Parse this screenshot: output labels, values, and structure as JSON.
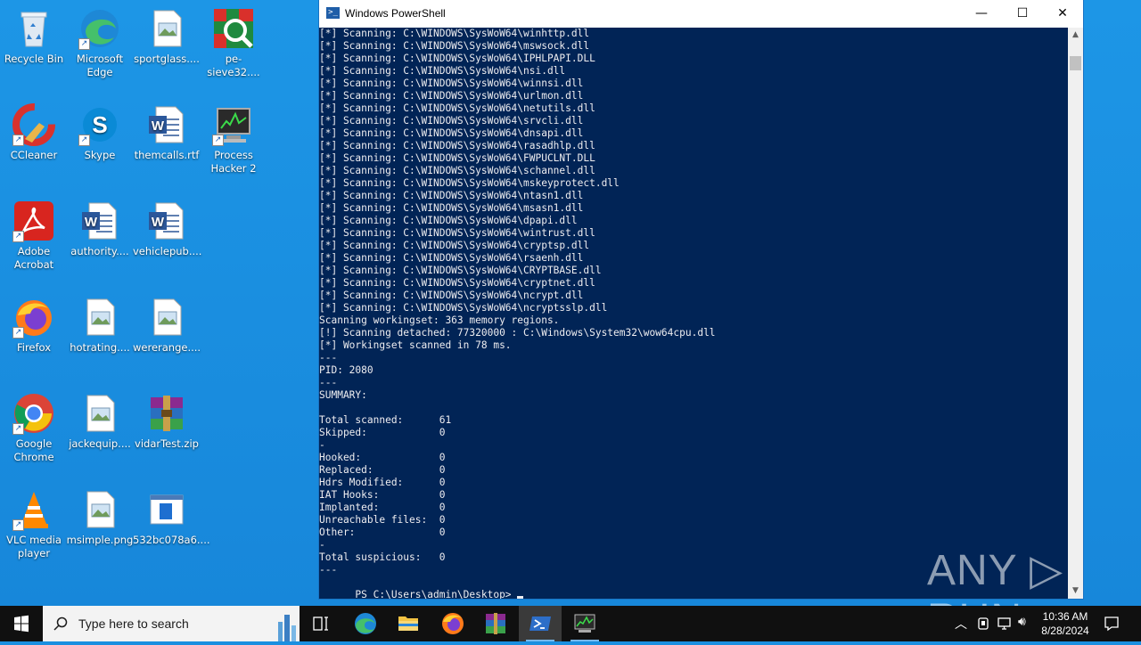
{
  "desktop_icons": [
    {
      "label": "Recycle Bin"
    },
    {
      "label": "Microsoft Edge"
    },
    {
      "label": "sportglass...."
    },
    {
      "label": "pe-sieve32...."
    },
    {
      "label": "CCleaner"
    },
    {
      "label": "Skype"
    },
    {
      "label": "themcalls.rtf"
    },
    {
      "label": "Process Hacker 2"
    },
    {
      "label": "Adobe Acrobat"
    },
    {
      "label": "authority...."
    },
    {
      "label": "vehiclepub...."
    },
    {
      "label": "Firefox"
    },
    {
      "label": "hotrating...."
    },
    {
      "label": "wererange...."
    },
    {
      "label": "Google Chrome"
    },
    {
      "label": "jackequip...."
    },
    {
      "label": "vidarTest.zip"
    },
    {
      "label": "VLC media player"
    },
    {
      "label": "msimple.png"
    },
    {
      "label": "532bc078a6...."
    }
  ],
  "window": {
    "title": "Windows PowerShell",
    "minimize": "—",
    "maximize": "☐",
    "close": "✕"
  },
  "console": {
    "lines": [
      "[*] Scanning: C:\\WINDOWS\\SysWoW64\\winhttp.dll",
      "[*] Scanning: C:\\WINDOWS\\SysWoW64\\mswsock.dll",
      "[*] Scanning: C:\\WINDOWS\\SysWoW64\\IPHLPAPI.DLL",
      "[*] Scanning: C:\\WINDOWS\\SysWoW64\\nsi.dll",
      "[*] Scanning: C:\\WINDOWS\\SysWoW64\\winnsi.dll",
      "[*] Scanning: C:\\WINDOWS\\SysWoW64\\urlmon.dll",
      "[*] Scanning: C:\\WINDOWS\\SysWoW64\\netutils.dll",
      "[*] Scanning: C:\\WINDOWS\\SysWoW64\\srvcli.dll",
      "[*] Scanning: C:\\WINDOWS\\SysWoW64\\dnsapi.dll",
      "[*] Scanning: C:\\WINDOWS\\SysWoW64\\rasadhlp.dll",
      "[*] Scanning: C:\\WINDOWS\\SysWoW64\\FWPUCLNT.DLL",
      "[*] Scanning: C:\\WINDOWS\\SysWoW64\\schannel.dll",
      "[*] Scanning: C:\\WINDOWS\\SysWoW64\\mskeyprotect.dll",
      "[*] Scanning: C:\\WINDOWS\\SysWoW64\\ntasn1.dll",
      "[*] Scanning: C:\\WINDOWS\\SysWoW64\\msasn1.dll",
      "[*] Scanning: C:\\WINDOWS\\SysWoW64\\dpapi.dll",
      "[*] Scanning: C:\\WINDOWS\\SysWoW64\\wintrust.dll",
      "[*] Scanning: C:\\WINDOWS\\SysWoW64\\cryptsp.dll",
      "[*] Scanning: C:\\WINDOWS\\SysWoW64\\rsaenh.dll",
      "[*] Scanning: C:\\WINDOWS\\SysWoW64\\CRYPTBASE.dll",
      "[*] Scanning: C:\\WINDOWS\\SysWoW64\\cryptnet.dll",
      "[*] Scanning: C:\\WINDOWS\\SysWoW64\\ncrypt.dll",
      "[*] Scanning: C:\\WINDOWS\\SysWoW64\\ncryptsslp.dll",
      "Scanning workingset: 363 memory regions.",
      "[!] Scanning detached: 77320000 : C:\\Windows\\System32\\wow64cpu.dll",
      "[*] Workingset scanned in 78 ms.",
      "---",
      "PID: 2080",
      "---",
      "SUMMARY:",
      "",
      "Total scanned:      61",
      "Skipped:            0",
      "-",
      "Hooked:             0",
      "Replaced:           0",
      "Hdrs Modified:      0",
      "IAT Hooks:          0",
      "Implanted:          0",
      "Unreachable files:  0",
      "Other:              0",
      "-",
      "Total suspicious:   0",
      "---"
    ],
    "prompt": "PS C:\\Users\\admin\\Desktop> "
  },
  "watermark": "ANY ▷ RUN",
  "taskbar": {
    "search_placeholder": "Type here to search",
    "time": "10:36 AM",
    "date": "8/28/2024"
  }
}
